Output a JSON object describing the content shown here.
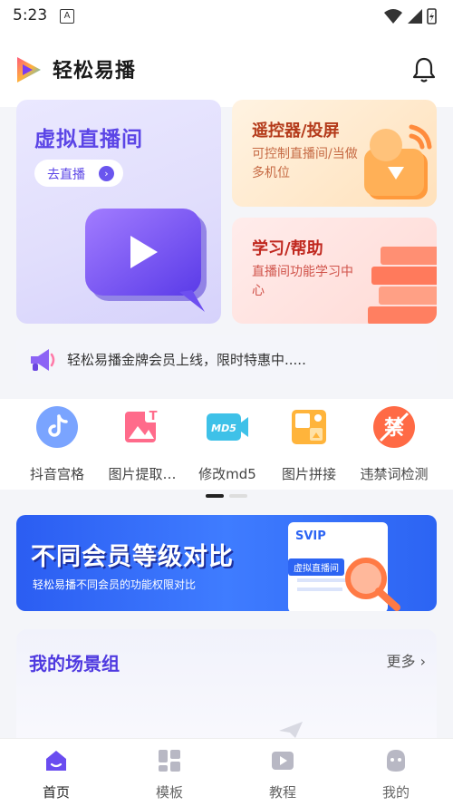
{
  "status_bar": {
    "time": "5:23",
    "notification_glyph": "A"
  },
  "header": {
    "app_name": "轻松易播"
  },
  "cards": {
    "main": {
      "title": "虚拟直播间",
      "button_label": "去直播"
    },
    "remote": {
      "title": "遥控器/投屏",
      "desc": "可控制直播间/当做多机位"
    },
    "help": {
      "title": "学习/帮助",
      "desc": "直播间功能学习中心"
    }
  },
  "notice": {
    "text": "轻松易播金牌会员上线，限时特惠中....."
  },
  "tools": [
    {
      "label": "抖音宫格",
      "icon": "douyin-icon"
    },
    {
      "label": "图片提取…",
      "icon": "image-extract-icon"
    },
    {
      "label": "修改md5",
      "icon": "md5-icon",
      "icon_text": "MD5"
    },
    {
      "label": "图片拼接",
      "icon": "image-stitch-icon"
    },
    {
      "label": "违禁词检测",
      "icon": "banned-words-icon",
      "icon_text": "禁"
    }
  ],
  "banner": {
    "headline": "不同会员等级对比",
    "subtitle": "轻松易播不同会员的功能权限对比",
    "card_title": "SVIP",
    "card_tag": "虚拟直播间"
  },
  "scene": {
    "title": "我的场景组",
    "more": "更多"
  },
  "tabbar": [
    {
      "label": "首页",
      "active": true
    },
    {
      "label": "模板",
      "active": false
    },
    {
      "label": "教程",
      "active": false
    },
    {
      "label": "我的",
      "active": false
    }
  ],
  "colors": {
    "accent": "#5b45e6",
    "banner": "#2c64f3",
    "warm": "#b43a1a"
  }
}
